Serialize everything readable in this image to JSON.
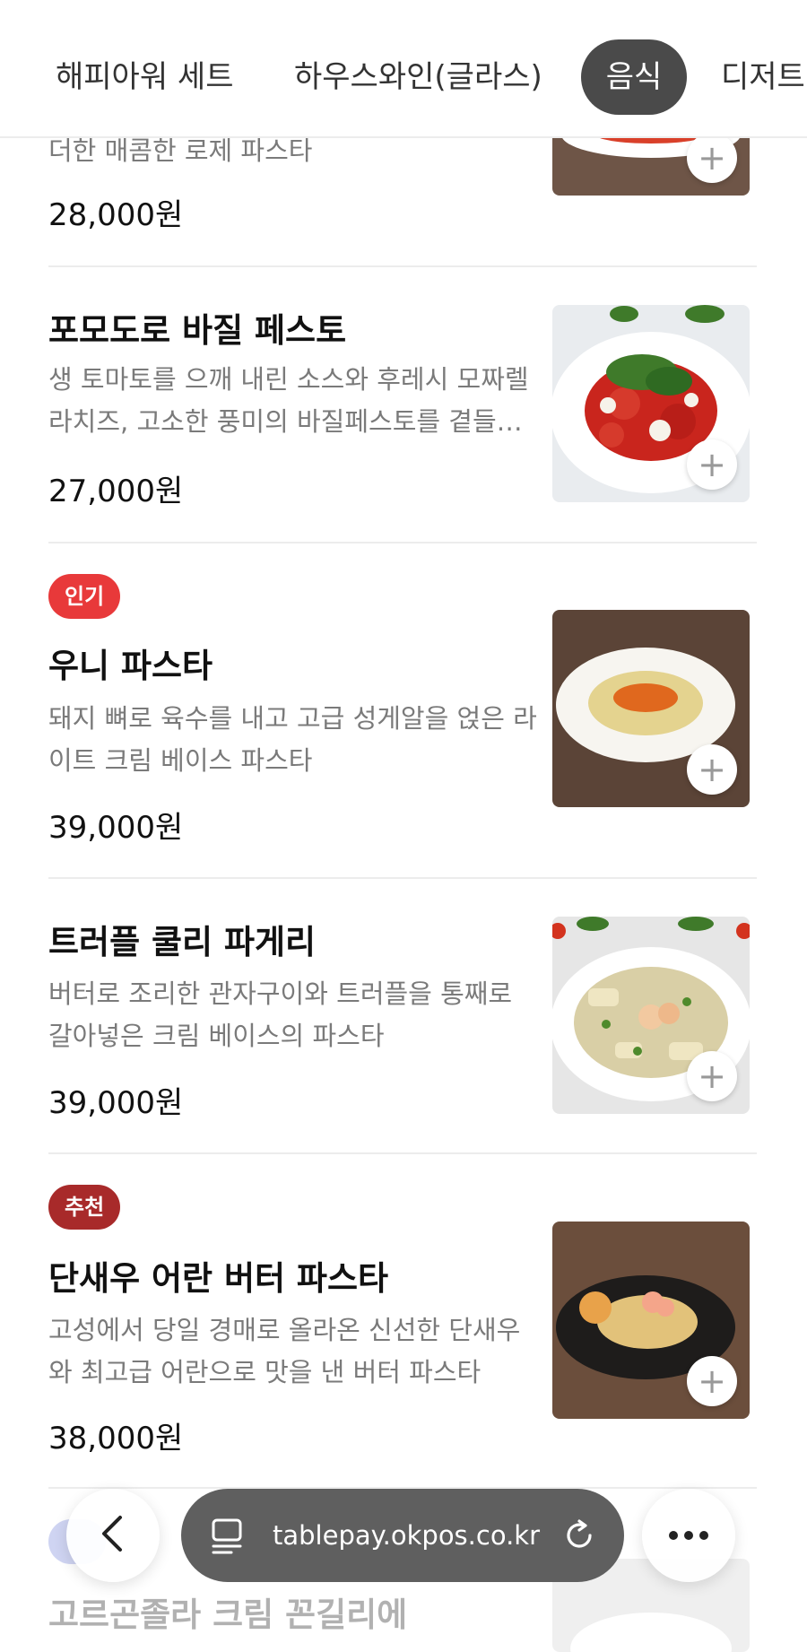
{
  "tabs": [
    {
      "label": "해피아워 세트",
      "active": false
    },
    {
      "label": "하우스와인(글라스)",
      "active": false
    },
    {
      "label": "음식",
      "active": true
    },
    {
      "label": "디저트",
      "active": false
    }
  ],
  "items": [
    {
      "badge": "",
      "name": "",
      "desc": "더한 매콤한 로제 파스타",
      "price": "28,000원"
    },
    {
      "badge": "",
      "name": "포모도로 바질 페스토",
      "desc": "생 토마토를 으깨 내린 소스와 후레시 모짜렐라치즈, 고소한 풍미의 바질페스토를 곁들인 파스타",
      "price": "27,000원"
    },
    {
      "badge": "인기",
      "badge_color": "#e8393a",
      "name": "우니 파스타",
      "desc": "돼지 뼈로 육수를 내고 고급 성게알을 얹은 라이트 크림 베이스 파스타",
      "price": "39,000원"
    },
    {
      "badge": "",
      "name": "트러플 쿨리 파게리",
      "desc": "버터로 조리한 관자구이와 트러플을 통째로 갈아넣은 크림 베이스의 파스타",
      "price": "39,000원"
    },
    {
      "badge": "추천",
      "badge_color": "#a82a2a",
      "name": "단새우 어란 버터 파스타",
      "desc": "고성에서 당일 경매로 올라온 신선한 단새우와 최고급 어란으로 맛을 낸 버터 파스타",
      "price": "38,000원"
    },
    {
      "badge": "",
      "name": "고르곤졸라 크림 꼰길리에",
      "desc": "",
      "price": ""
    }
  ],
  "add_symbol": "+",
  "browser": {
    "url": "tablepay.okpos.co.kr"
  },
  "colors": {
    "active_tab": "#4a4a4a",
    "badge_popular": "#e8393a",
    "badge_recommend": "#a82a2a"
  }
}
